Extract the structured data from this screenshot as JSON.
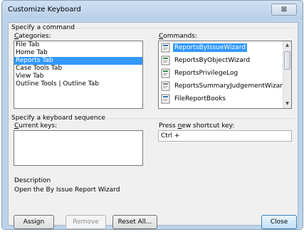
{
  "dialog": {
    "title": "Customize Keyboard",
    "close_glyph": "⊠"
  },
  "command_section": {
    "group_label": "Specify a command",
    "categories_label": "Categories:",
    "categories_label_accel": "C",
    "categories_label_rest": "ategories:",
    "commands_label_accel": "C",
    "commands_label_rest": "ommands:",
    "categories": [
      "File Tab",
      "Home Tab",
      "Reports Tab",
      "Case Tools Tab",
      "View Tab",
      "Outline Tools | Outline Tab"
    ],
    "selected_category": "Reports Tab",
    "commands": [
      "ReportsByIssueWizard",
      "ReportsByObjectWizard",
      "ReportsPrivilegeLog",
      "ReportsSummaryJudgementWizard",
      "FileReportBooks"
    ],
    "selected_command": "ReportsByIssueWizard"
  },
  "keyboard_section": {
    "group_label": "Specify a keyboard sequence",
    "current_keys_accel": "C",
    "current_keys_rest": "urrent keys:",
    "new_shortcut_pre": "Press ",
    "new_shortcut_accel": "n",
    "new_shortcut_post": "ew shortcut key:",
    "new_shortcut_value": "Ctrl +"
  },
  "description": {
    "label": "Description",
    "text": "Open the By Issue Report Wizard"
  },
  "buttons": {
    "assign": "Assign",
    "remove": "Remove",
    "reset_all": "Reset All...",
    "close": "Close"
  }
}
